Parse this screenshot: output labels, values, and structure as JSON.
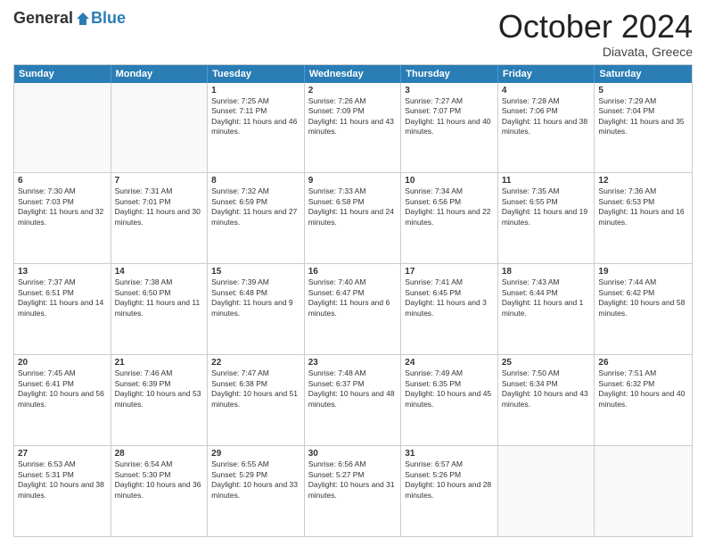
{
  "header": {
    "logo_general": "General",
    "logo_blue": "Blue",
    "month_title": "October 2024",
    "location": "Diavata, Greece"
  },
  "weekdays": [
    "Sunday",
    "Monday",
    "Tuesday",
    "Wednesday",
    "Thursday",
    "Friday",
    "Saturday"
  ],
  "rows": [
    [
      {
        "day": "",
        "info": "",
        "empty": true
      },
      {
        "day": "",
        "info": "",
        "empty": true
      },
      {
        "day": "1",
        "info": "Sunrise: 7:25 AM\nSunset: 7:11 PM\nDaylight: 11 hours and 46 minutes."
      },
      {
        "day": "2",
        "info": "Sunrise: 7:26 AM\nSunset: 7:09 PM\nDaylight: 11 hours and 43 minutes."
      },
      {
        "day": "3",
        "info": "Sunrise: 7:27 AM\nSunset: 7:07 PM\nDaylight: 11 hours and 40 minutes."
      },
      {
        "day": "4",
        "info": "Sunrise: 7:28 AM\nSunset: 7:06 PM\nDaylight: 11 hours and 38 minutes."
      },
      {
        "day": "5",
        "info": "Sunrise: 7:29 AM\nSunset: 7:04 PM\nDaylight: 11 hours and 35 minutes."
      }
    ],
    [
      {
        "day": "6",
        "info": "Sunrise: 7:30 AM\nSunset: 7:03 PM\nDaylight: 11 hours and 32 minutes."
      },
      {
        "day": "7",
        "info": "Sunrise: 7:31 AM\nSunset: 7:01 PM\nDaylight: 11 hours and 30 minutes."
      },
      {
        "day": "8",
        "info": "Sunrise: 7:32 AM\nSunset: 6:59 PM\nDaylight: 11 hours and 27 minutes."
      },
      {
        "day": "9",
        "info": "Sunrise: 7:33 AM\nSunset: 6:58 PM\nDaylight: 11 hours and 24 minutes."
      },
      {
        "day": "10",
        "info": "Sunrise: 7:34 AM\nSunset: 6:56 PM\nDaylight: 11 hours and 22 minutes."
      },
      {
        "day": "11",
        "info": "Sunrise: 7:35 AM\nSunset: 6:55 PM\nDaylight: 11 hours and 19 minutes."
      },
      {
        "day": "12",
        "info": "Sunrise: 7:36 AM\nSunset: 6:53 PM\nDaylight: 11 hours and 16 minutes."
      }
    ],
    [
      {
        "day": "13",
        "info": "Sunrise: 7:37 AM\nSunset: 6:51 PM\nDaylight: 11 hours and 14 minutes."
      },
      {
        "day": "14",
        "info": "Sunrise: 7:38 AM\nSunset: 6:50 PM\nDaylight: 11 hours and 11 minutes."
      },
      {
        "day": "15",
        "info": "Sunrise: 7:39 AM\nSunset: 6:48 PM\nDaylight: 11 hours and 9 minutes."
      },
      {
        "day": "16",
        "info": "Sunrise: 7:40 AM\nSunset: 6:47 PM\nDaylight: 11 hours and 6 minutes."
      },
      {
        "day": "17",
        "info": "Sunrise: 7:41 AM\nSunset: 6:45 PM\nDaylight: 11 hours and 3 minutes."
      },
      {
        "day": "18",
        "info": "Sunrise: 7:43 AM\nSunset: 6:44 PM\nDaylight: 11 hours and 1 minute."
      },
      {
        "day": "19",
        "info": "Sunrise: 7:44 AM\nSunset: 6:42 PM\nDaylight: 10 hours and 58 minutes."
      }
    ],
    [
      {
        "day": "20",
        "info": "Sunrise: 7:45 AM\nSunset: 6:41 PM\nDaylight: 10 hours and 56 minutes."
      },
      {
        "day": "21",
        "info": "Sunrise: 7:46 AM\nSunset: 6:39 PM\nDaylight: 10 hours and 53 minutes."
      },
      {
        "day": "22",
        "info": "Sunrise: 7:47 AM\nSunset: 6:38 PM\nDaylight: 10 hours and 51 minutes."
      },
      {
        "day": "23",
        "info": "Sunrise: 7:48 AM\nSunset: 6:37 PM\nDaylight: 10 hours and 48 minutes."
      },
      {
        "day": "24",
        "info": "Sunrise: 7:49 AM\nSunset: 6:35 PM\nDaylight: 10 hours and 45 minutes."
      },
      {
        "day": "25",
        "info": "Sunrise: 7:50 AM\nSunset: 6:34 PM\nDaylight: 10 hours and 43 minutes."
      },
      {
        "day": "26",
        "info": "Sunrise: 7:51 AM\nSunset: 6:32 PM\nDaylight: 10 hours and 40 minutes."
      }
    ],
    [
      {
        "day": "27",
        "info": "Sunrise: 6:53 AM\nSunset: 5:31 PM\nDaylight: 10 hours and 38 minutes."
      },
      {
        "day": "28",
        "info": "Sunrise: 6:54 AM\nSunset: 5:30 PM\nDaylight: 10 hours and 36 minutes."
      },
      {
        "day": "29",
        "info": "Sunrise: 6:55 AM\nSunset: 5:29 PM\nDaylight: 10 hours and 33 minutes."
      },
      {
        "day": "30",
        "info": "Sunrise: 6:56 AM\nSunset: 5:27 PM\nDaylight: 10 hours and 31 minutes."
      },
      {
        "day": "31",
        "info": "Sunrise: 6:57 AM\nSunset: 5:26 PM\nDaylight: 10 hours and 28 minutes."
      },
      {
        "day": "",
        "info": "",
        "empty": true
      },
      {
        "day": "",
        "info": "",
        "empty": true
      }
    ]
  ]
}
